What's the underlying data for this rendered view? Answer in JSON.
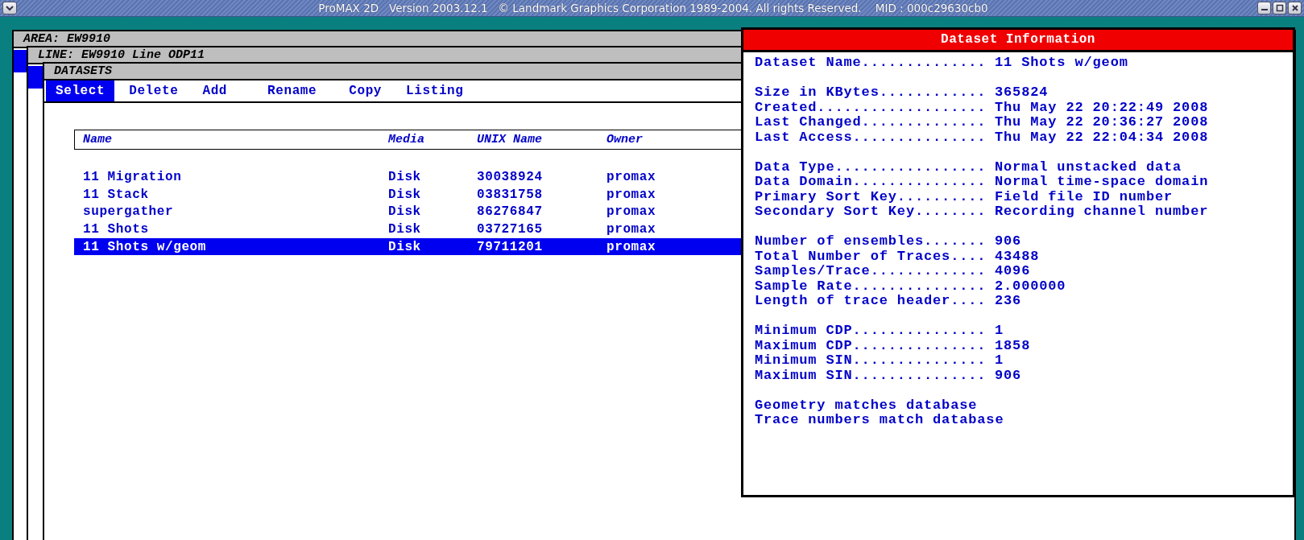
{
  "title_bar": {
    "title": "ProMAX 2D   Version 2003.12.1   © Landmark Graphics Corporation 1989-2004. All rights Reserved.    MID : 000c29630cb0"
  },
  "area_window": {
    "title": "AREA: EW9910"
  },
  "line_window": {
    "title": "LINE: EW9910 Line ODP11"
  },
  "datasets_window": {
    "title": "DATASETS",
    "menu": [
      {
        "label": "Select",
        "selected": true
      },
      {
        "label": "Delete",
        "selected": false
      },
      {
        "label": "Add",
        "selected": false
      },
      {
        "label": "Rename",
        "selected": false
      },
      {
        "label": "Copy",
        "selected": false
      },
      {
        "label": "Listing",
        "selected": false
      }
    ],
    "table": {
      "columns": [
        "Name",
        "Media",
        "UNIX Name",
        "Owner"
      ],
      "rows": [
        {
          "cells": [
            "11 Migration",
            "Disk",
            "30038924",
            "promax"
          ],
          "selected": false
        },
        {
          "cells": [
            "11 Stack",
            "Disk",
            "03831758",
            "promax"
          ],
          "selected": false
        },
        {
          "cells": [
            "supergather",
            "Disk",
            "86276847",
            "promax"
          ],
          "selected": false
        },
        {
          "cells": [
            "11 Shots",
            "Disk",
            "03727165",
            "promax"
          ],
          "selected": false
        },
        {
          "cells": [
            "11 Shots w/geom",
            "Disk",
            "79711201",
            "promax"
          ],
          "selected": true
        }
      ]
    }
  },
  "info_panel": {
    "title": "Dataset Information",
    "sections": [
      {
        "kind": "fields",
        "rows": [
          {
            "label": "Dataset Name..............",
            "value": "11 Shots w/geom"
          }
        ]
      },
      {
        "kind": "fields",
        "rows": [
          {
            "label": "Size in KBytes............",
            "value": "365824"
          },
          {
            "label": "Created...................",
            "value": "Thu May 22 20:22:49 2008"
          },
          {
            "label": "Last Changed..............",
            "value": "Thu May 22 20:36:27 2008"
          },
          {
            "label": "Last Access...............",
            "value": "Thu May 22 22:04:34 2008"
          }
        ]
      },
      {
        "kind": "fields",
        "rows": [
          {
            "label": "Data Type.................",
            "value": "Normal unstacked data"
          },
          {
            "label": "Data Domain...............",
            "value": "Normal time-space domain"
          },
          {
            "label": "Primary Sort Key..........",
            "value": "Field file ID number"
          },
          {
            "label": "Secondary Sort Key........",
            "value": "Recording channel number"
          }
        ]
      },
      {
        "kind": "fields",
        "rows": [
          {
            "label": "Number of ensembles.......",
            "value": "906"
          },
          {
            "label": "Total Number of Traces....",
            "value": "43488"
          },
          {
            "label": "Samples/Trace.............",
            "value": "4096"
          },
          {
            "label": "Sample Rate...............",
            "value": "2.000000"
          },
          {
            "label": "Length of trace header....",
            "value": "236"
          }
        ]
      },
      {
        "kind": "fields",
        "rows": [
          {
            "label": "Minimum CDP...............",
            "value": "1"
          },
          {
            "label": "Maximum CDP...............",
            "value": "1858"
          },
          {
            "label": "Minimum SIN...............",
            "value": "1"
          },
          {
            "label": "Maximum SIN...............",
            "value": "906"
          }
        ]
      },
      {
        "kind": "notes",
        "lines": [
          "Geometry matches database",
          "Trace numbers match database"
        ]
      }
    ]
  }
}
